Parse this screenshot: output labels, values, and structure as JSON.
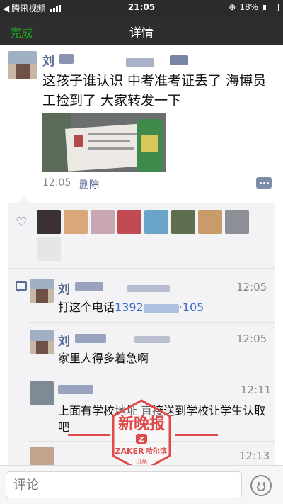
{
  "status_bar": {
    "back_app": "腾讯视频",
    "time": "21:05",
    "battery": "18%",
    "battery_level": 0.18
  },
  "navbar": {
    "done": "完成",
    "title": "详情"
  },
  "post": {
    "author": "刘",
    "text": "这孩子谁认识 中考准考证丢了 海博员工捡到了 大家转发一下",
    "time": "12:05",
    "delete": "删除"
  },
  "comments": [
    {
      "author": "刘",
      "time": "12:05",
      "text": "打这个电话",
      "phone_start": "1392",
      "phone_end": "·105"
    },
    {
      "author": "刘",
      "time": "12:05",
      "text": "家里人得多着急啊"
    },
    {
      "author": "",
      "time": "12:11",
      "text": "上面有学校地址 直接送到学校让学生认取吧"
    },
    {
      "author": "",
      "time": "12:13",
      "text": ""
    }
  ],
  "input": {
    "placeholder": "评论"
  },
  "watermark": {
    "title": "新晚报",
    "brand": "ZAKER",
    "city": "哈尔滨",
    "sub": "出品",
    "color": "#e04a4a"
  },
  "colors": {
    "link": "#576b95",
    "accent": "#1aad19",
    "nav_bg": "#2e2e30"
  }
}
